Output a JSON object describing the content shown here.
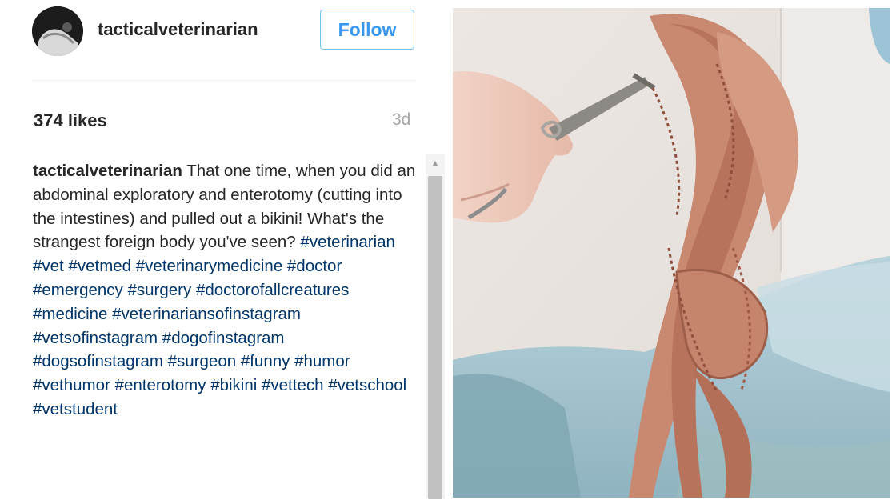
{
  "post": {
    "username": "tacticalveterinarian",
    "follow_label": "Follow",
    "likes": "374 likes",
    "time_ago": "3d",
    "caption": {
      "username": "tacticalveterinarian",
      "text": "That one time, when you did an abdominal exploratory and enterotomy (cutting into the intestines) and pulled out a bikini! What's the strangest foreign body you've seen?",
      "hashtags": "#veterinarian #vet #vetmed #veterinarymedicine #doctor #emergency #surgery #doctorofallcreatures #medicine #veterinariansofinstagram #vetsofinstagram #dogofinstagram #dogsofinstagram #surgeon #funny #humor #vethumor #enterotomy #bikini #vettech #vetschool #vetstudent"
    }
  },
  "colors": {
    "follow_text": "#3897f0",
    "follow_border": "#70c0e7",
    "hashtag": "#003569",
    "muted": "#a5a5a5"
  },
  "icons": {
    "scroll_up": "scroll-up-arrow-icon"
  }
}
